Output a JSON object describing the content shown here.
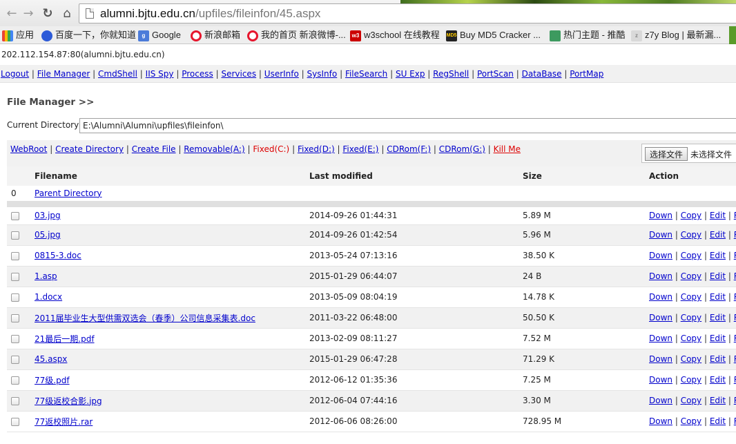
{
  "browser": {
    "url_host": "alumni.bjtu.edu.cn",
    "url_path": "/upfiles/fileinfon/45.aspx",
    "bookmarks": [
      {
        "label": "应用",
        "icon": "apps-grid-icon"
      },
      {
        "label": "百度一下，你就知道",
        "icon": "baidu-paw-icon"
      },
      {
        "label": "Google",
        "icon": "google-icon"
      },
      {
        "label": "新浪邮箱",
        "icon": "weibo-icon"
      },
      {
        "label": "我的首页 新浪微博-...",
        "icon": "weibo-icon"
      },
      {
        "label": "w3school 在线教程",
        "icon": "w3school-icon"
      },
      {
        "label": "Buy MD5 Cracker ...",
        "icon": "md5-icon"
      },
      {
        "label": "热门主题 - 推酷",
        "icon": "tuicool-icon"
      },
      {
        "label": "z7y Blog | 最新漏...",
        "icon": "z7y-icon"
      }
    ]
  },
  "page": {
    "host_line": "202.112.154.87:80(alumni.bjtu.edu.cn)",
    "menu": [
      "Logout",
      "File Manager",
      "CmdShell",
      "IIS Spy",
      "Process",
      "Services",
      "UserInfo",
      "SysInfo",
      "FileSearch",
      "SU Exp",
      "RegShell",
      "PortScan",
      "DataBase",
      "PortMap"
    ],
    "title": "File Manager >>",
    "current_dir_label": "Current Directory :",
    "current_dir_value": "E:\\Alumni\\Alumni\\upfiles\\fileinfon\\",
    "drive_links": [
      {
        "label": "WebRoot",
        "style": "normal"
      },
      {
        "label": "Create Directory",
        "style": "normal"
      },
      {
        "label": "Create File",
        "style": "normal"
      },
      {
        "label": "Removable(A:)",
        "style": "normal"
      },
      {
        "label": "Fixed(C:)",
        "style": "red"
      },
      {
        "label": "Fixed(D:)",
        "style": "normal"
      },
      {
        "label": "Fixed(E:)",
        "style": "normal"
      },
      {
        "label": "CDRom(F:)",
        "style": "normal"
      },
      {
        "label": "CDRom(G:)",
        "style": "normal"
      },
      {
        "label": "Kill Me",
        "style": "kill"
      }
    ],
    "upload_button": "选择文件",
    "no_file_text": "未选择文件",
    "table": {
      "headers": {
        "filename": "Filename",
        "modified": "Last modified",
        "size": "Size",
        "action": "Action"
      },
      "parent_index": "0",
      "parent_label": "Parent Directory",
      "actions": [
        "Down",
        "Copy",
        "Edit",
        "Ren"
      ],
      "files": [
        {
          "name": "03.jpg",
          "modified": "2014-09-26 01:44:31",
          "size": "5.89 M"
        },
        {
          "name": "05.jpg",
          "modified": "2014-09-26 01:42:54",
          "size": "5.96 M"
        },
        {
          "name": "0815-3.doc",
          "modified": "2013-05-24 07:13:16",
          "size": "38.50 K"
        },
        {
          "name": "1.asp",
          "modified": "2015-01-29 06:44:07",
          "size": "24 B"
        },
        {
          "name": "1.docx",
          "modified": "2013-05-09 08:04:19",
          "size": "14.78 K"
        },
        {
          "name": "2011届毕业生大型供需双选会（春季）公司信息采集表.doc",
          "modified": "2011-03-22 06:48:00",
          "size": "50.50 K"
        },
        {
          "name": "21最后一期.pdf",
          "modified": "2013-02-09 08:11:27",
          "size": "7.52 M"
        },
        {
          "name": "45.aspx",
          "modified": "2015-01-29 06:47:28",
          "size": "71.29 K"
        },
        {
          "name": "77级.pdf",
          "modified": "2012-06-12 01:35:36",
          "size": "7.25 M"
        },
        {
          "name": "77级返校合影.jpg",
          "modified": "2012-06-04 07:44:16",
          "size": "3.30 M"
        },
        {
          "name": "77返校照片.rar",
          "modified": "2012-06-06 08:26:00",
          "size": "728.95 M"
        }
      ]
    }
  }
}
